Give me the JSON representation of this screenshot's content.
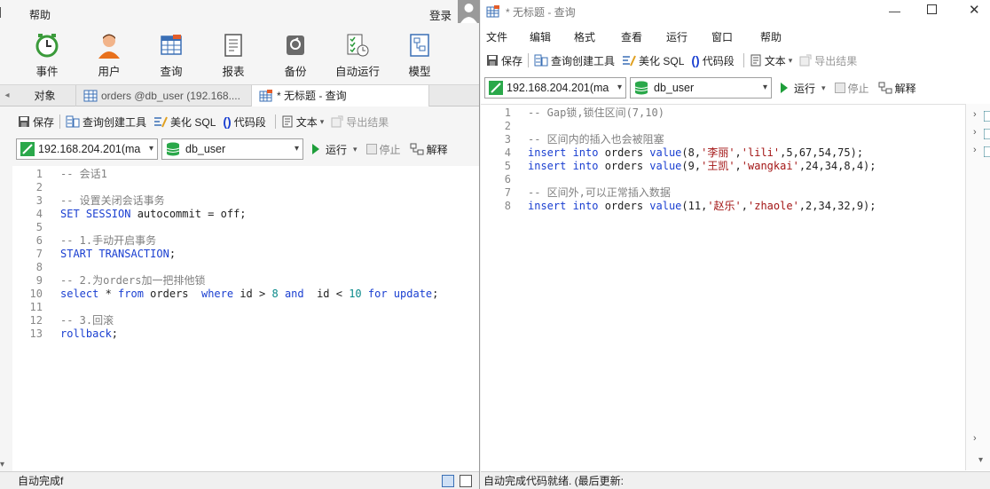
{
  "left": {
    "menu": {
      "help": "帮助",
      "login": "登录"
    },
    "ribbon": [
      {
        "label": "事件",
        "icon": "clock-icon"
      },
      {
        "label": "用户",
        "icon": "user-icon"
      },
      {
        "label": "查询",
        "icon": "query-icon"
      },
      {
        "label": "报表",
        "icon": "report-icon"
      },
      {
        "label": "备份",
        "icon": "backup-icon"
      },
      {
        "label": "自动运行",
        "icon": "autorun-icon"
      },
      {
        "label": "模型",
        "icon": "model-icon"
      }
    ],
    "tabs": {
      "objects": "对象",
      "orders": "orders @db_user (192.168....",
      "untitled": "* 无标题 - 查询"
    },
    "toolbar": {
      "save": "保存",
      "query_builder": "查询创建工具",
      "beautify": "美化 SQL",
      "snippet": "代码段",
      "text": "文本",
      "export": "导出结果"
    },
    "connection": "192.168.204.201(ma",
    "database": "db_user",
    "run": "运行",
    "stop": "停止",
    "explain": "解释",
    "status": "自动完成f"
  },
  "right": {
    "title": "* 无标题 - 查询",
    "menu": {
      "file": "文件",
      "edit": "编辑",
      "format": "格式",
      "view": "查看",
      "run": "运行",
      "window": "窗口",
      "help": "帮助"
    },
    "toolbar": {
      "save": "保存",
      "query_builder": "查询创建工具",
      "beautify": "美化 SQL",
      "snippet": "代码段",
      "text": "文本",
      "export": "导出结果"
    },
    "connection": "192.168.204.201(ma",
    "database": "db_user",
    "run": "运行",
    "stop": "停止",
    "explain": "解释",
    "status": "自动完成代码就绪. (最后更新:"
  },
  "left_code": [
    {
      "n": "1",
      "parts": [
        [
          "cm",
          "-- 会话1"
        ]
      ]
    },
    {
      "n": "2",
      "parts": []
    },
    {
      "n": "3",
      "parts": [
        [
          "cm",
          "-- 设置关闭会话事务"
        ]
      ]
    },
    {
      "n": "4",
      "parts": [
        [
          "kw",
          "SET SESSION"
        ],
        [
          "",
          " autocommit = off;"
        ]
      ]
    },
    {
      "n": "5",
      "parts": []
    },
    {
      "n": "6",
      "parts": [
        [
          "cm",
          "-- 1.手动开启事务"
        ]
      ]
    },
    {
      "n": "7",
      "parts": [
        [
          "kw",
          "START TRANSACTION"
        ],
        [
          "",
          ";"
        ]
      ]
    },
    {
      "n": "8",
      "parts": []
    },
    {
      "n": "9",
      "parts": [
        [
          "cm",
          "-- 2.为orders加一把排他锁"
        ]
      ]
    },
    {
      "n": "10",
      "parts": [
        [
          "kw",
          "select"
        ],
        [
          "",
          " * "
        ],
        [
          "kw",
          "from"
        ],
        [
          "",
          " orders  "
        ],
        [
          "kw",
          "where"
        ],
        [
          "",
          " id > "
        ],
        [
          "num",
          "8"
        ],
        [
          "",
          " "
        ],
        [
          "kw",
          "and"
        ],
        [
          "",
          "  id < "
        ],
        [
          "num",
          "10"
        ],
        [
          "",
          " "
        ],
        [
          "kw",
          "for update"
        ],
        [
          "",
          ";"
        ]
      ]
    },
    {
      "n": "11",
      "parts": []
    },
    {
      "n": "12",
      "parts": [
        [
          "cm",
          "-- 3.回滚"
        ]
      ]
    },
    {
      "n": "13",
      "parts": [
        [
          "kw",
          "rollback"
        ],
        [
          "",
          ";"
        ]
      ]
    }
  ],
  "right_code": [
    {
      "n": "1",
      "parts": [
        [
          "cm",
          "-- Gap锁,锁住区间(7,10)"
        ]
      ]
    },
    {
      "n": "2",
      "parts": []
    },
    {
      "n": "3",
      "parts": [
        [
          "cm",
          "-- 区间内的插入也会被阻塞"
        ]
      ]
    },
    {
      "n": "4",
      "parts": [
        [
          "kw",
          "insert into"
        ],
        [
          "",
          " orders "
        ],
        [
          "kw",
          "value"
        ],
        [
          "",
          "(8,"
        ],
        [
          "str",
          "'李丽'"
        ],
        [
          "",
          ","
        ],
        [
          "str",
          "'lili'"
        ],
        [
          "",
          ",5,67,54,75);"
        ]
      ]
    },
    {
      "n": "5",
      "parts": [
        [
          "kw",
          "insert into"
        ],
        [
          "",
          " orders "
        ],
        [
          "kw",
          "value"
        ],
        [
          "",
          "(9,"
        ],
        [
          "str",
          "'王凯'"
        ],
        [
          "",
          ","
        ],
        [
          "str",
          "'wangkai'"
        ],
        [
          "",
          ",24,34,8,4);"
        ]
      ]
    },
    {
      "n": "6",
      "parts": []
    },
    {
      "n": "7",
      "parts": [
        [
          "cm",
          "-- 区间外,可以正常插入数据"
        ]
      ]
    },
    {
      "n": "8",
      "parts": [
        [
          "kw",
          "insert into"
        ],
        [
          "",
          " orders "
        ],
        [
          "kw",
          "value"
        ],
        [
          "",
          "(11,"
        ],
        [
          "str",
          "'赵乐'"
        ],
        [
          "",
          ","
        ],
        [
          "str",
          "'zhaole'"
        ],
        [
          "",
          ",2,34,32,9);"
        ]
      ]
    }
  ],
  "colors": {
    "keyword": "#1a3fd1",
    "comment": "#808080",
    "string": "#a31515",
    "number": "#0a8a8a",
    "run_green": "#1e9e3a"
  }
}
